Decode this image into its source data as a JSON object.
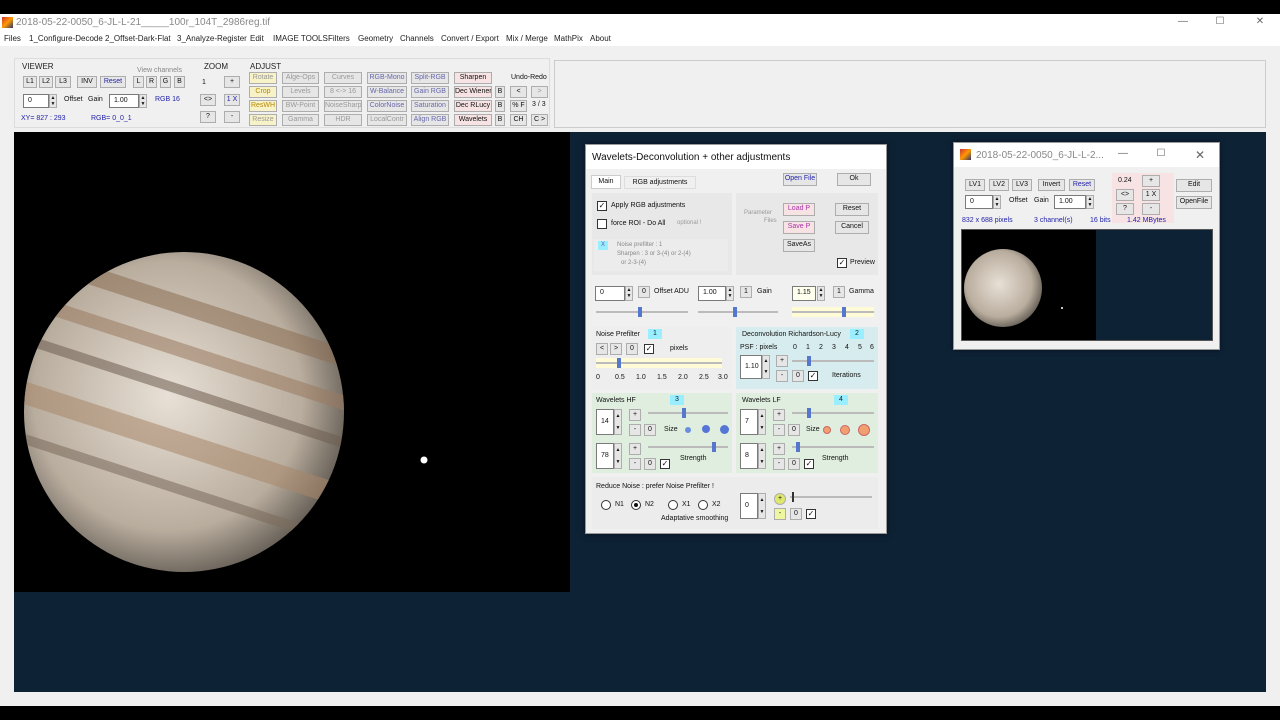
{
  "window": {
    "title": "2018-05-22-0050_6-JL-L-21_____100r_104T_2986reg.tif",
    "min": "—",
    "max": "☐",
    "close": "✕"
  },
  "menu": [
    "Files",
    "1_Configure-Decode",
    "2_Offset-Dark-Flat",
    "3_Analyze-Register",
    "Edit",
    "IMAGE TOOLS",
    "Filters",
    "Geometry",
    "Channels",
    "Convert / Export",
    "Mix / Merge",
    "MathPix",
    "About"
  ],
  "viewer": {
    "label": "VIEWER",
    "view_channels": "View channels",
    "buttons": [
      "L1",
      "L2",
      "L3",
      "INV",
      "Reset",
      "L",
      "R",
      "G",
      "B"
    ],
    "offset_value": "0",
    "offset_label": "Offset",
    "gain_label": "Gain",
    "gain_value": "1.00",
    "rgb_bits": "RGB 16",
    "xy": "XY=  827 : 293",
    "rgb": "RGB=  0_0_1"
  },
  "zoom": {
    "label": "ZOOM",
    "value": "1",
    "plus": "+",
    "swap": "<>",
    "onex": "1 X",
    "help": "?",
    "minus": "-"
  },
  "adjust": {
    "label": "ADJUST",
    "rows": [
      [
        "Rotate",
        "Alge-Ops",
        "Curves",
        "RGB-Mono",
        "Split-RGB",
        "Sharpen"
      ],
      [
        "Crop",
        "Levels",
        "8 <-> 16",
        "W-Balance",
        "Gain RGB",
        "Dec Wiener"
      ],
      [
        "ResWH",
        "BW-Point",
        "NoiseSharp",
        "ColorNoise",
        "Saturation",
        "Dec RLucy"
      ],
      [
        "Resize",
        "Gamma",
        "HDR",
        "LocalContr",
        "Align RGB",
        "Wavelets"
      ]
    ],
    "b": "B",
    "undo_label": "Undo-Redo",
    "undo": "<",
    "redo": ">",
    "pf": "% F",
    "count": "3 / 3",
    "ch": "CH",
    "cnext": "C >"
  },
  "dialog": {
    "title": "Wavelets-Deconvolution + other adjustments",
    "tabs": [
      "Main",
      "RGB adjustments"
    ],
    "open_file": "Open File",
    "ok": "Ok",
    "apply_rgb": "Apply RGB adjustments",
    "force_roi": "force ROI - Do All",
    "optional": "optional !",
    "x": "X",
    "hint1": "Noise prefilter :  1",
    "hint2": "Sharpen :  3  or  3-(4)  or  2-(4)",
    "hint3": "or  2-3-(4)",
    "param_files": "Parameter",
    "param_files2": "Files",
    "load_p": "Load P",
    "save_p": "Save P",
    "save_as": "SaveAs",
    "reset": "Reset",
    "cancel": "Cancel",
    "preview": "Preview",
    "offset_val": "0",
    "offset_zero": "0",
    "offset_label": "Offset ADU",
    "gain_val": "1.00",
    "gain_one": "1",
    "gain_label": "Gain",
    "gamma_val": "1.15",
    "gamma_one": "1",
    "gamma_label": "Gamma",
    "noise": {
      "title": "Noise Prefilter",
      "badge": "1",
      "prev": "<",
      "next": ">",
      "zero": "0",
      "pixels": "pixels",
      "ticks": [
        "0",
        "0.5",
        "1.0",
        "1.5",
        "2.0",
        "2.5",
        "3.0"
      ]
    },
    "decon": {
      "title": "Deconvolution Richardson-Lucy",
      "badge": "2",
      "psf": "PSF : pixels",
      "ticks": [
        "0",
        "1",
        "2",
        "3",
        "4",
        "5",
        "6"
      ],
      "value": "1.10",
      "plus": "+",
      "minus": "-",
      "zero": "0",
      "iterations": "Iterations"
    },
    "hf": {
      "title": "Wavelets HF",
      "badge": "3",
      "size_val": "14",
      "strength_val": "78",
      "plus": "+",
      "minus": "-",
      "zero": "0",
      "size": "Size",
      "strength": "Strength"
    },
    "lf": {
      "title": "Wavelets LF",
      "badge": "4",
      "size_val": "7",
      "strength_val": "8",
      "plus": "+",
      "minus": "-",
      "zero": "0",
      "size": "Size",
      "strength": "Strength"
    },
    "reduce": {
      "title": "Reduce Noise :  prefer Noise Prefilter !",
      "options": [
        "N1",
        "N2",
        "X1",
        "X2"
      ],
      "smoothing": "Adaptative smoothing",
      "value": "0",
      "plus": "+",
      "minus": "-",
      "zero": "0"
    }
  },
  "mini": {
    "title": "2018-05-22-0050_6-JL-L-2...",
    "min": "—",
    "max": "☐",
    "close": "✕",
    "buttons": [
      "LV1",
      "LV2",
      "LV3",
      "Invert",
      "Reset"
    ],
    "zoom": "0.24",
    "plus": "+",
    "swap": "<>",
    "onex": "1 X",
    "help": "?",
    "minus": "-",
    "edit": "Edit",
    "openfile": "OpenFile",
    "offset_val": "0",
    "offset": "Offset",
    "gain": "Gain",
    "gain_val": "1.00",
    "info": [
      "832  x  688  pixels",
      "3  channel(s)",
      "16 bits",
      "1.42 MBytes"
    ]
  },
  "colors": {
    "bg_workspace": "#0e2236",
    "accent_blue": "#2233aa"
  }
}
